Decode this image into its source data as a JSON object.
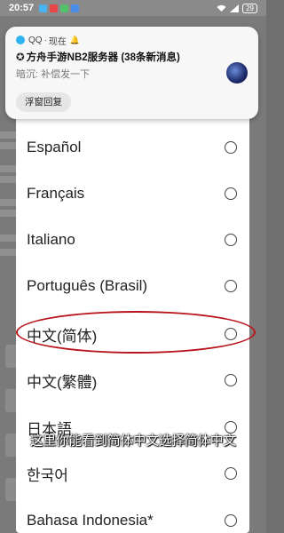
{
  "status_bar": {
    "time": "20:57",
    "battery": "29",
    "icons": [
      "qq-icon",
      "red-app-icon",
      "green-app-icon",
      "blue-app-icon",
      "wifi-icon",
      "signal-icon",
      "battery-icon"
    ]
  },
  "notification": {
    "app_name": "QQ",
    "separator": "·",
    "time": "现在",
    "bell": "🔔",
    "title_lead": "✪",
    "title": "方舟手游NB2服务器 (38条新消息)",
    "message": "暗沉: 补偿发一下",
    "reply_label": "浮窗回复"
  },
  "language_list": {
    "items": [
      {
        "label": "Español"
      },
      {
        "label": "Français"
      },
      {
        "label": "Italiano"
      },
      {
        "label": "Português (Brasil)"
      },
      {
        "label": "中文(简体)"
      },
      {
        "label": "中文(繁體)"
      },
      {
        "label": "日本語"
      },
      {
        "label": "한국어"
      },
      {
        "label": "Bahasa Indonesia*"
      }
    ]
  },
  "caption": "这里你能看到简体中文选择简体中文",
  "colors": {
    "highlight": "#b8141c",
    "dialog_bg": "#ffffff",
    "overlay": "#767676"
  }
}
